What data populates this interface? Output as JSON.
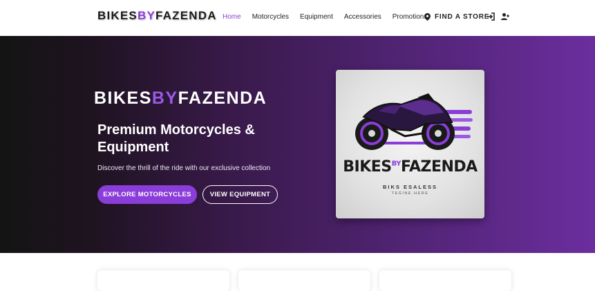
{
  "brand": {
    "part1": "BIKES",
    "part2": "BY",
    "part3": "FAZENDA"
  },
  "nav": {
    "links": [
      "Home",
      "Motorcycles",
      "Equipment",
      "Accessories",
      "Promotions"
    ],
    "store_label": "FIND A STORE"
  },
  "hero": {
    "logo": {
      "part1": "BIKES",
      "part2": "BY",
      "part3": "FAZENDA"
    },
    "title": "Premium Motorcycles & Equipment",
    "subtitle": "Discover the thrill of the ride with our exclusive collection",
    "primary_button": "EXPLORE MOTORCYCLES",
    "secondary_button": "VIEW EQUIPMENT",
    "image": {
      "brand_main1": "BIKES",
      "brand_by": "BY",
      "brand_main2": "FAZENDA",
      "tagline": "BIKS ESALESS",
      "tagline2": "TEGINE HERE"
    }
  },
  "colors": {
    "accent": "#8b3dd9",
    "hero_dark": "#141414",
    "hero_purple": "#6b2e9e"
  },
  "icons": [
    "map-marker-icon",
    "sign-in-icon",
    "user-plus-icon"
  ]
}
